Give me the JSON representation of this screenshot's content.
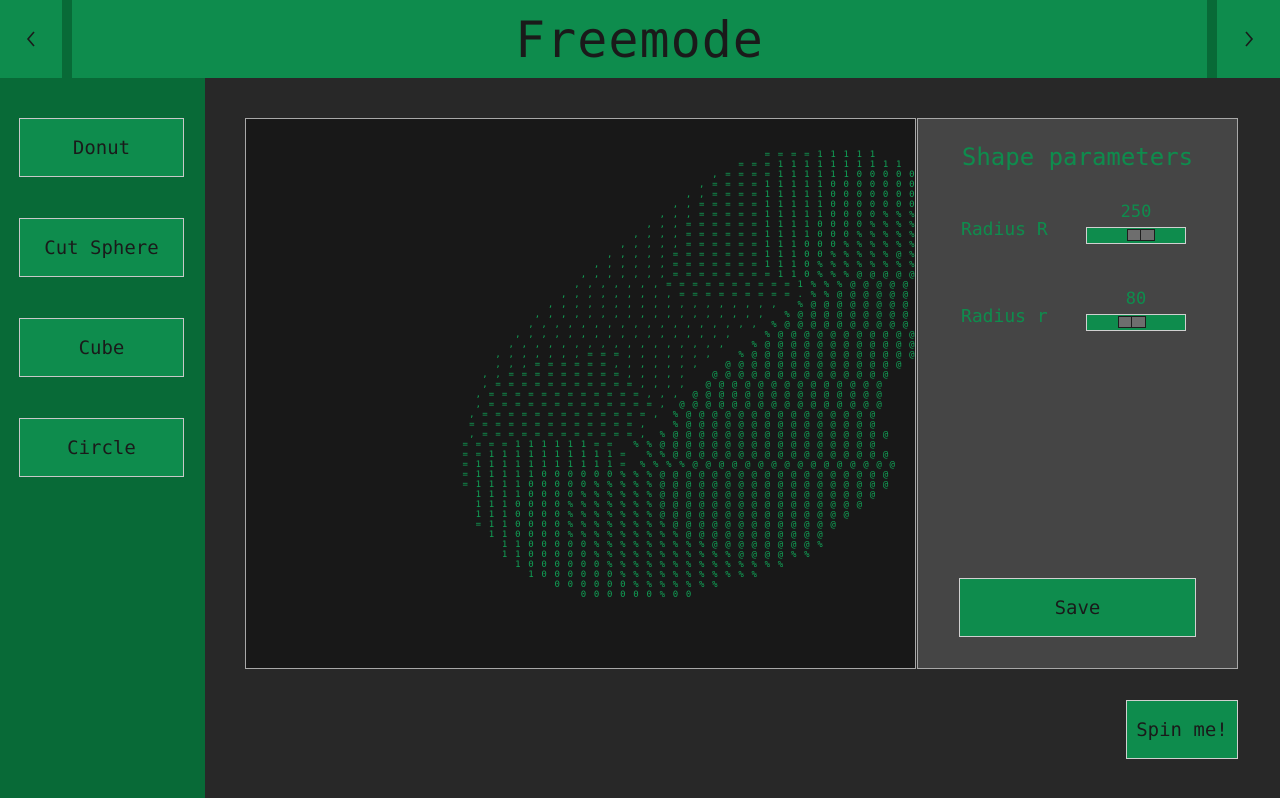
{
  "header": {
    "title": "Freemode",
    "prev_icon": "chevron-left-icon",
    "next_icon": "chevron-right-icon"
  },
  "sidebar": {
    "items": [
      {
        "label": "Donut"
      },
      {
        "label": "Cut Sphere"
      },
      {
        "label": "Cube"
      },
      {
        "label": "Circle"
      }
    ]
  },
  "canvas": {
    "ascii_art": [
      "                                                             = = = = 1 1 1 1 1",
      "                                                         = = = 1 1 1 1 1 1 1 1 1 1",
      "                                                     , = = = = 1 1 1 1 1 1 0 0 0 0 0 1",
      "                                                   , = = = = 1 1 1 1 1 0 0 0 0 0 0 0 0 1",
      "                                                 , , = = = = 1 1 1 1 1 0 0 0 0 0 0 0 0 0 0",
      "                                               , , = = = = = 1 1 1 1 1 0 0 0 0 0 0 0 0 0 0",
      "                                             , , , = = = = = 1 1 1 1 1 0 0 0 0 % % % % % 0 0",
      "                                           , , , = = = = = = 1 1 1 1 0 0 0 0 % % % % % % % % 0",
      "                                         , , , , = = = = = = 1 1 1 1 0 0 0 % % % % % % % % % 0",
      "                                       , , , , , = = = = = = 1 1 1 0 0 0 % % % % % % % % % % 0",
      "                                     , , , , , = = = = = = = 1 1 1 0 0 % % % % % @ % % % % % %",
      "                                   , , , , , , = = = = = = = 1 1 1 0 % % % % % % % % % % % % 0",
      "                                 , , , , , , , = = = = = = = = 1 1 0 % % % @ @ @ @ @ @ % % % %",
      "                                , , , , , , , = = = = = = = = = = 1 % % % @ @ @ @ @ @ @ @ % % %",
      "                              , , , , , , , , , = = = = = = = = = . % % @ @ @ @ @ @ @ @ @ % %",
      "                            , , , , , , , , , , , , , , , , , ,   % @ @ @ @ @ @ @ @ @ @ @ % %",
      "                          , , , , , , , , , , , , , , , , , ,   % @ @ @ @ @ @ @ @ @ @ @ % %",
      "                         , , , , , , , , , , , , , , , , , ,  % @ @ @ @ @ @ @ @ @ @ @ @ %",
      "                       , , , , , , , , , , , , , , , , ,     % @ @ @ @ @ @ @ @ @ @ @ @ %",
      "                      , , , , , , , , , , , , , , , , ,    % @ @ @ @ @ @ @ @ @ @ @ @ %",
      "                    , , , , , , , = = = , , , , , , ,    % @ @ @ @ @ @ @ @ @ @ @ @ @",
      "                    , , , = = = = = = , , , , , , ,    @ @ @ @ @ @ @ @ @ @ @ @ @ @",
      "                  , , = = = = = = = = = , , , , ,    @ @ @ @ @ @ @ @ @ @ @ @ @ @",
      "                  , = = = = = = = = = = = , , , ,   @ @ @ @ @ @ @ @ @ @ @ @ @ @",
      "                 , = = = = = = = = = = = = , , ,  @ @ @ @ @ @ @ @ @ @ @ @ @ @ @",
      "                 , = = = = = = = = = = = = = ,  @ @ @ @ @ @ @ @ @ @ @ @ @ @ @ @",
      "                , = = = = = = = = = = = = = ,  % @ @ @ @ @ @ @ @ @ @ @ @ @ @ @",
      "                = = = = = = = = = = = = = ,    % @ @ @ @ @ @ @ @ @ @ @ @ @ @ @",
      "                , = = = = = = = = = = = = ,  % @ @ @ @ @ @ @ @ @ @ @ @ @ @ @ @ @",
      "               = = = = 1 1 1 1 1 1 = =   % % @ @ @ @ @ @ @ @ @ @ @ @ @ @ @ @ @",
      "               = = 1 1 1 1 1 1 1 1 1 1 =   % % @ @ @ @ @ @ @ @ @ @ @ @ @ @ @ @ @",
      "               = 1 1 1 1 1 1 1 1 1 1 1 =  % % % % @ @ @ @ @ @ @ @ @ @ @ @ @ @ @ @",
      "               = 1 1 1 1 1 0 0 0 0 0 0 % % % @ @ @ @ @ @ @ @ @ @ @ @ @ @ @ @ @ @",
      "               = 1 1 1 1 0 0 0 0 0 % % % % % @ @ @ @ @ @ @ @ @ @ @ @ @ @ @ @ @ @",
      "                 1 1 1 1 0 0 0 0 % % % % % % @ @ @ @ @ @ @ @ @ @ @ @ @ @ @ @ @",
      "                 1 1 1 0 0 0 0 % % % % % % % @ @ @ @ @ @ @ @ @ @ @ @ @ @ @ @",
      "                 1 1 1 0 0 0 0 % % % % % % % @ @ @ @ @ @ @ @ @ @ @ @ @ @ @",
      "                 = 1 1 0 0 0 0 % % % % % % % % @ @ @ @ @ @ @ @ @ @ @ @ @",
      "                   1 1 0 0 0 0 % % % % % % % % % @ @ @ @ @ @ @ @ @ @ @",
      "                     1 1 0 0 0 0 0 % % % % % % % % % @ @ @ @ @ @ @ @ %",
      "                     1 1 0 0 0 0 0 % % % % % % % % % % % @ @ @ @ % %",
      "                       1 0 0 0 0 0 0 % % % % % % % % % % % % % %",
      "                         1 0 0 0 0 0 0 % % % % % % % % % % %",
      "                             0 0 0 0 0 0 % % % % % % %",
      "                                 0 0 0 0 0 0 % 0 0"
    ]
  },
  "params": {
    "title": "Shape parameters",
    "radius_R": {
      "label": "Radius R",
      "value": "250",
      "level": 0.57
    },
    "radius_r": {
      "label": "Radius r",
      "value": "80",
      "level": 0.44
    },
    "save_label": "Save"
  },
  "spin_label": "Spin me!",
  "colors": {
    "accent": "#0e8c4d",
    "accent_dark": "#086a37",
    "background": "#282828",
    "canvas": "#181818",
    "panel": "#454545",
    "ascii": "#10a055"
  }
}
